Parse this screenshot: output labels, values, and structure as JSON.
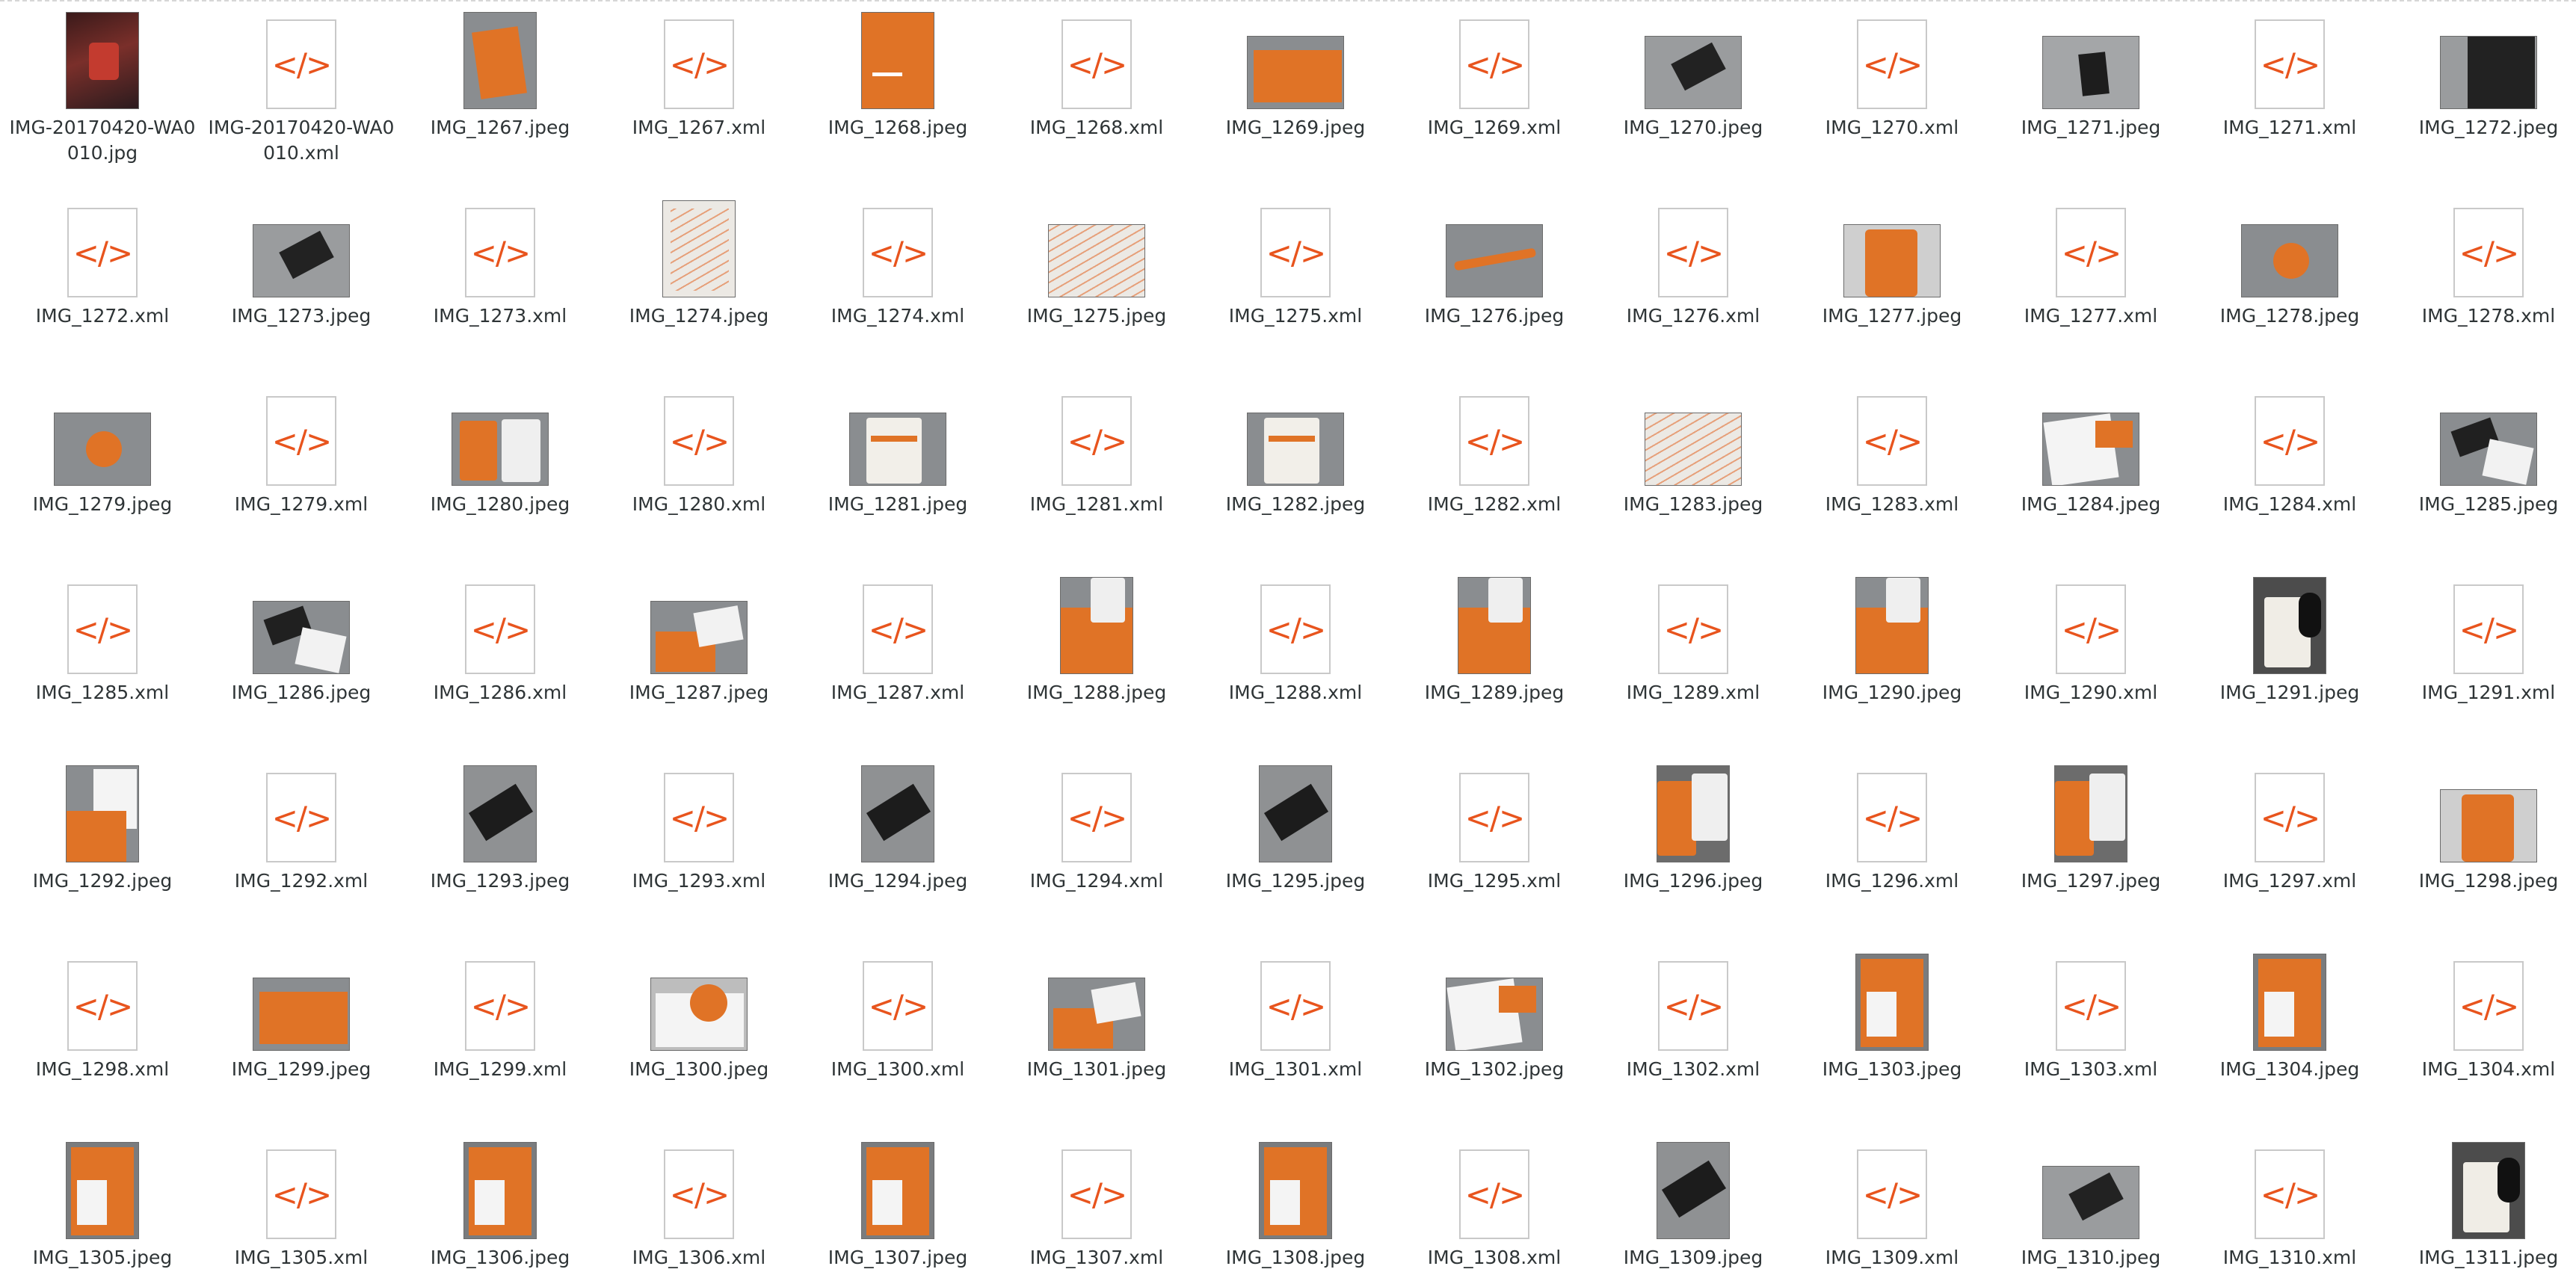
{
  "files": [
    {
      "name": "IMG-20170420-WA0010.jpg",
      "kind": "photo",
      "style": "wa"
    },
    {
      "name": "IMG-20170420-WA0010.xml",
      "kind": "xml"
    },
    {
      "name": "IMG_1267.jpeg",
      "kind": "photo",
      "style": "notebook"
    },
    {
      "name": "IMG_1267.xml",
      "kind": "xml"
    },
    {
      "name": "IMG_1268.jpeg",
      "kind": "photo",
      "style": "notebook-tall"
    },
    {
      "name": "IMG_1268.xml",
      "kind": "xml"
    },
    {
      "name": "IMG_1269.jpeg",
      "kind": "photo",
      "style": "notebook-flat"
    },
    {
      "name": "IMG_1269.xml",
      "kind": "xml"
    },
    {
      "name": "IMG_1270.jpeg",
      "kind": "photo",
      "style": "card-angle"
    },
    {
      "name": "IMG_1270.xml",
      "kind": "xml"
    },
    {
      "name": "IMG_1271.jpeg",
      "kind": "photo",
      "style": "card-grey"
    },
    {
      "name": "IMG_1271.xml",
      "kind": "xml"
    },
    {
      "name": "IMG_1272.jpeg",
      "kind": "photo",
      "style": "card-dark"
    },
    {
      "name": "IMG_1272.xml",
      "kind": "xml"
    },
    {
      "name": "IMG_1273.jpeg",
      "kind": "photo",
      "style": "card-angle"
    },
    {
      "name": "IMG_1273.xml",
      "kind": "xml"
    },
    {
      "name": "IMG_1274.jpeg",
      "kind": "photo",
      "style": "paper"
    },
    {
      "name": "IMG_1274.xml",
      "kind": "xml"
    },
    {
      "name": "IMG_1275.jpeg",
      "kind": "photo",
      "style": "paper-flat"
    },
    {
      "name": "IMG_1275.xml",
      "kind": "xml"
    },
    {
      "name": "IMG_1276.jpeg",
      "kind": "photo",
      "style": "pen"
    },
    {
      "name": "IMG_1276.xml",
      "kind": "xml"
    },
    {
      "name": "IMG_1277.jpeg",
      "kind": "photo",
      "style": "mug-orange"
    },
    {
      "name": "IMG_1277.xml",
      "kind": "xml"
    },
    {
      "name": "IMG_1278.jpeg",
      "kind": "photo",
      "style": "button"
    },
    {
      "name": "IMG_1278.xml",
      "kind": "xml"
    },
    {
      "name": "IMG_1279.jpeg",
      "kind": "photo",
      "style": "button"
    },
    {
      "name": "IMG_1279.xml",
      "kind": "xml"
    },
    {
      "name": "IMG_1280.jpeg",
      "kind": "photo",
      "style": "mugs"
    },
    {
      "name": "IMG_1280.xml",
      "kind": "xml"
    },
    {
      "name": "IMG_1281.jpeg",
      "kind": "photo",
      "style": "mug-white"
    },
    {
      "name": "IMG_1281.xml",
      "kind": "xml"
    },
    {
      "name": "IMG_1282.jpeg",
      "kind": "photo",
      "style": "mug-white"
    },
    {
      "name": "IMG_1282.xml",
      "kind": "xml"
    },
    {
      "name": "IMG_1283.jpeg",
      "kind": "photo",
      "style": "paper-flat"
    },
    {
      "name": "IMG_1283.xml",
      "kind": "xml"
    },
    {
      "name": "IMG_1284.jpeg",
      "kind": "photo",
      "style": "doc"
    },
    {
      "name": "IMG_1284.xml",
      "kind": "xml"
    },
    {
      "name": "IMG_1285.jpeg",
      "kind": "photo",
      "style": "mix"
    },
    {
      "name": "IMG_1285.xml",
      "kind": "xml"
    },
    {
      "name": "IMG_1286.jpeg",
      "kind": "photo",
      "style": "mix"
    },
    {
      "name": "IMG_1286.xml",
      "kind": "xml"
    },
    {
      "name": "IMG_1287.jpeg",
      "kind": "photo",
      "style": "mix-orange"
    },
    {
      "name": "IMG_1287.xml",
      "kind": "xml"
    },
    {
      "name": "IMG_1288.jpeg",
      "kind": "photo",
      "style": "notebook-mug"
    },
    {
      "name": "IMG_1288.xml",
      "kind": "xml"
    },
    {
      "name": "IMG_1289.jpeg",
      "kind": "photo",
      "style": "notebook-mug"
    },
    {
      "name": "IMG_1289.xml",
      "kind": "xml"
    },
    {
      "name": "IMG_1290.jpeg",
      "kind": "photo",
      "style": "notebook-mug"
    },
    {
      "name": "IMG_1290.xml",
      "kind": "xml"
    },
    {
      "name": "IMG_1291.jpeg",
      "kind": "photo",
      "style": "mug-portrait"
    },
    {
      "name": "IMG_1291.xml",
      "kind": "xml"
    },
    {
      "name": "IMG_1292.jpeg",
      "kind": "photo",
      "style": "notebook-doc"
    },
    {
      "name": "IMG_1292.xml",
      "kind": "xml"
    },
    {
      "name": "IMG_1293.jpeg",
      "kind": "photo",
      "style": "card-portrait"
    },
    {
      "name": "IMG_1293.xml",
      "kind": "xml"
    },
    {
      "name": "IMG_1294.jpeg",
      "kind": "photo",
      "style": "card-portrait"
    },
    {
      "name": "IMG_1294.xml",
      "kind": "xml"
    },
    {
      "name": "IMG_1295.jpeg",
      "kind": "photo",
      "style": "card-portrait"
    },
    {
      "name": "IMG_1295.xml",
      "kind": "xml"
    },
    {
      "name": "IMG_1296.jpeg",
      "kind": "photo",
      "style": "mugs-portrait"
    },
    {
      "name": "IMG_1296.xml",
      "kind": "xml"
    },
    {
      "name": "IMG_1297.jpeg",
      "kind": "photo",
      "style": "mugs-portrait"
    },
    {
      "name": "IMG_1297.xml",
      "kind": "xml"
    },
    {
      "name": "IMG_1298.jpeg",
      "kind": "photo",
      "style": "mug-orange"
    },
    {
      "name": "IMG_1298.xml",
      "kind": "xml"
    },
    {
      "name": "IMG_1299.jpeg",
      "kind": "photo",
      "style": "notebook-flat"
    },
    {
      "name": "IMG_1299.xml",
      "kind": "xml"
    },
    {
      "name": "IMG_1300.jpeg",
      "kind": "photo",
      "style": "doc-orange"
    },
    {
      "name": "IMG_1300.xml",
      "kind": "xml"
    },
    {
      "name": "IMG_1301.jpeg",
      "kind": "photo",
      "style": "mix-orange"
    },
    {
      "name": "IMG_1301.xml",
      "kind": "xml"
    },
    {
      "name": "IMG_1302.jpeg",
      "kind": "photo",
      "style": "doc"
    },
    {
      "name": "IMG_1302.xml",
      "kind": "xml"
    },
    {
      "name": "IMG_1303.jpeg",
      "kind": "photo",
      "style": "notebook-cards"
    },
    {
      "name": "IMG_1303.xml",
      "kind": "xml"
    },
    {
      "name": "IMG_1304.jpeg",
      "kind": "photo",
      "style": "notebook-cards"
    },
    {
      "name": "IMG_1304.xml",
      "kind": "xml"
    },
    {
      "name": "IMG_1305.jpeg",
      "kind": "photo",
      "style": "notebook-cards"
    },
    {
      "name": "IMG_1305.xml",
      "kind": "xml"
    },
    {
      "name": "IMG_1306.jpeg",
      "kind": "photo",
      "style": "notebook-cards"
    },
    {
      "name": "IMG_1306.xml",
      "kind": "xml"
    },
    {
      "name": "IMG_1307.jpeg",
      "kind": "photo",
      "style": "notebook-cards"
    },
    {
      "name": "IMG_1307.xml",
      "kind": "xml"
    },
    {
      "name": "IMG_1308.jpeg",
      "kind": "photo",
      "style": "notebook-cards"
    },
    {
      "name": "IMG_1308.xml",
      "kind": "xml"
    },
    {
      "name": "IMG_1309.jpeg",
      "kind": "photo",
      "style": "card-portrait"
    },
    {
      "name": "IMG_1309.xml",
      "kind": "xml"
    },
    {
      "name": "IMG_1310.jpeg",
      "kind": "photo",
      "style": "card-angle"
    },
    {
      "name": "IMG_1310.xml",
      "kind": "xml"
    },
    {
      "name": "IMG_1311.jpeg",
      "kind": "photo",
      "style": "mug-portrait"
    }
  ],
  "xml_glyph": "</>",
  "colors": {
    "xml_accent": "#e8541d",
    "brand_orange": "#e07326",
    "table_grey": "#8a8d90",
    "label_text": "#2e3436"
  }
}
